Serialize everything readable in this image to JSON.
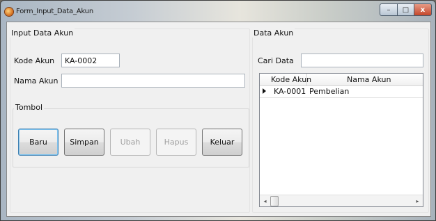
{
  "window": {
    "title": "Form_Input_Data_Akun",
    "min_glyph": "–",
    "max_glyph": "□",
    "close_glyph": "x"
  },
  "input_group": {
    "title": "Input Data Akun",
    "kode_label": "Kode Akun",
    "kode_value": "KA-0002",
    "nama_label": "Nama Akun",
    "nama_value": ""
  },
  "tombol_group": {
    "title": "Tombol",
    "buttons": [
      {
        "label": "Baru",
        "enabled": true,
        "focused": true
      },
      {
        "label": "Simpan",
        "enabled": true,
        "focused": false
      },
      {
        "label": "Ubah",
        "enabled": false,
        "focused": false
      },
      {
        "label": "Hapus",
        "enabled": false,
        "focused": false
      },
      {
        "label": "Keluar",
        "enabled": true,
        "focused": false
      }
    ]
  },
  "data_group": {
    "title": "Data Akun",
    "search_label": "Cari Data",
    "search_value": ""
  },
  "grid": {
    "columns": [
      "Kode Akun",
      "Nama Akun"
    ],
    "rows": [
      {
        "kode": "KA-0001",
        "nama": "Pembelian"
      }
    ],
    "scroll_left_glyph": "◂",
    "scroll_right_glyph": "▸"
  }
}
